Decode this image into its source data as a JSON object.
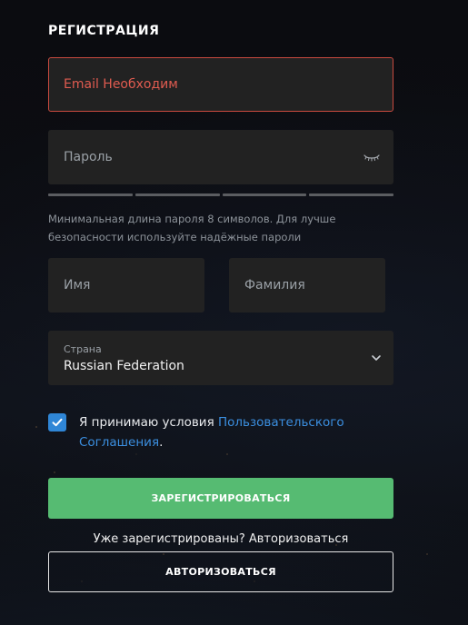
{
  "page": {
    "title": "РЕГИСТРАЦИЯ"
  },
  "form": {
    "email": {
      "error_text": "Email Необходим"
    },
    "password": {
      "placeholder": "Пароль",
      "hint": "Минимальная длина пароля 8 символов. Для лучше безопасности используйте надёжные пароли",
      "toggle_icon": "eye-closed-icon"
    },
    "first_name": {
      "placeholder": "Имя"
    },
    "last_name": {
      "placeholder": "Фамилия"
    },
    "country": {
      "label": "Страна",
      "selected": "Russian Federation",
      "icon": "chevron-down-icon"
    },
    "terms": {
      "checked": true,
      "prefix": "Я принимаю условия ",
      "link_text": "Пользовательского Соглашения",
      "suffix": "."
    }
  },
  "actions": {
    "register_label": "ЗАРЕГИСТРИРОВАТЬСЯ",
    "already_text": "Уже зарегистрированы? Авторизоваться",
    "login_label": "АВТОРИЗОВАТЬСЯ"
  },
  "colors": {
    "error": "#e05b50",
    "primary": "#56bb72",
    "link": "#3b8fe0",
    "checkbox": "#2f86d6"
  }
}
